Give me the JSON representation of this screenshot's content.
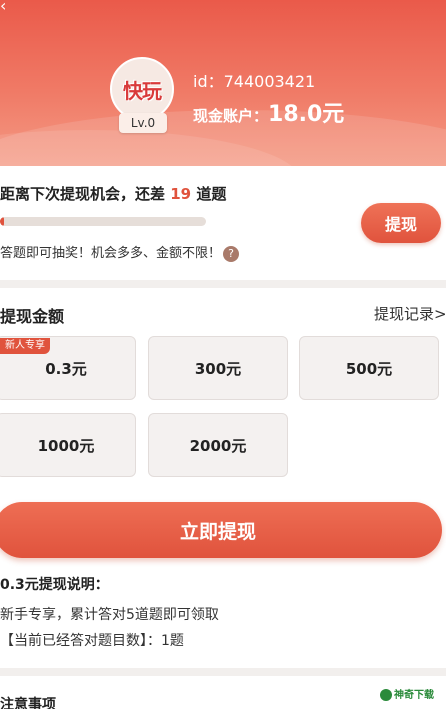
{
  "header": {
    "avatar_logo": "快玩",
    "level": "Lv.0",
    "uid": "id：744003421",
    "balance_label": "现金账户：",
    "balance_amount": "18.0元"
  },
  "progress": {
    "next_prefix": "距离下次提现机会，还差",
    "remaining": "19",
    "next_suffix": "道题",
    "fraction": 0.02,
    "hint": "答题即可抽奖！机会多多、金额不限！",
    "help_icon": "?",
    "withdraw_label": "提现"
  },
  "amounts": {
    "title": "提现金额",
    "record_link": "提现记录>",
    "badge": "新人专享",
    "options": [
      "0.3元",
      "300元",
      "500元",
      "1000元",
      "2000元"
    ]
  },
  "submit_label": "立即提现",
  "explain": {
    "title": "0.3元提现说明：",
    "line1": "新手专享，累计答对5道题即可领取",
    "line2": "【当前已经答对题目数】：1题"
  },
  "notice_title": "注意事项",
  "watermark": "神奇下载",
  "colors": {
    "accent": "#e0533d",
    "header": "#ea5a4a"
  }
}
